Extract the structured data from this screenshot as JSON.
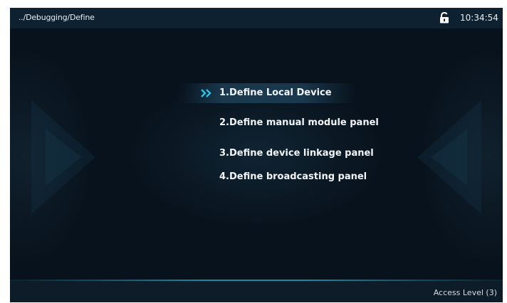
{
  "header": {
    "breadcrumb": "../Debugging/Define",
    "lock_icon": "unlocked-padlock-icon",
    "time": "10:34:54"
  },
  "menu": {
    "selected_index": 0,
    "items": [
      {
        "label": "1.Define Local Device"
      },
      {
        "label": "2.Define manual module panel"
      },
      {
        "label": "3.Define device linkage panel"
      },
      {
        "label": "4.Define broadcasting panel"
      }
    ],
    "selection_icon": "double-chevron-right-icon"
  },
  "footer": {
    "access_level": "Access Level (3)"
  },
  "colors": {
    "background": "#08121c",
    "top_bar": "#0d2130",
    "accent": "#1a8aa0",
    "chevron": "#26c4e8",
    "text": "#f2f5f8"
  }
}
